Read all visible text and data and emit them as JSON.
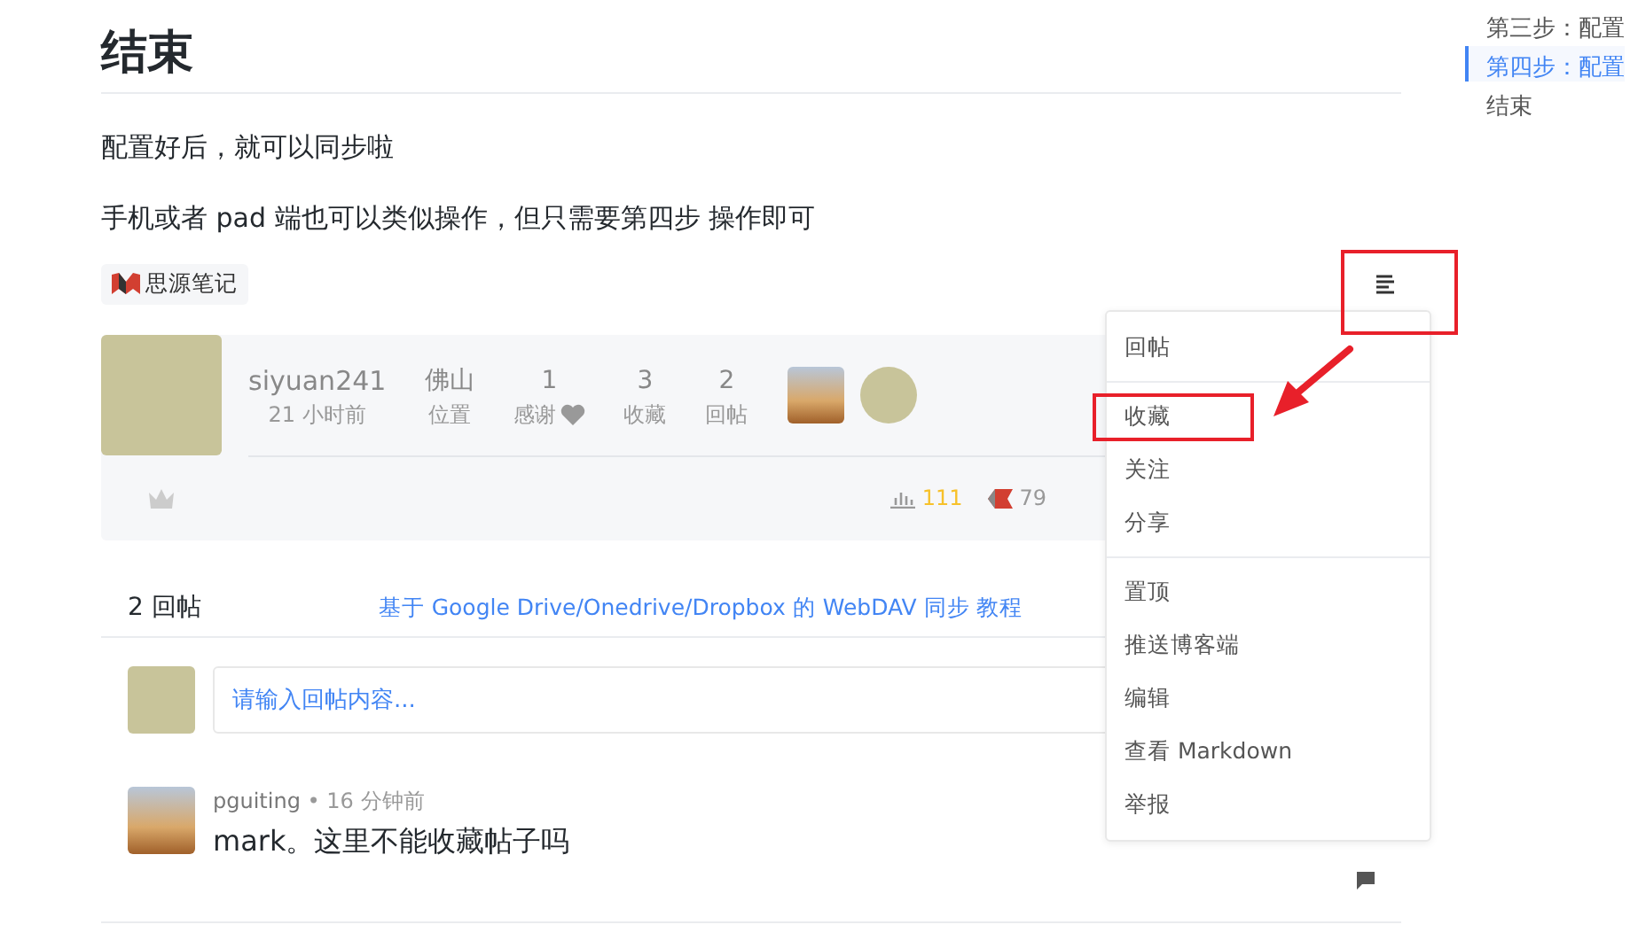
{
  "article": {
    "heading": "结束",
    "paragraphs": [
      "配置好后，就可以同步啦",
      "手机或者 pad 端也可以类似操作，但只需要第四步 操作即可"
    ],
    "tag": "思源笔记"
  },
  "menu_button": {
    "annotated": true
  },
  "post": {
    "author": "siyuan241",
    "time": "21 小时前",
    "location": "佛山",
    "location_label": "位置",
    "stats": [
      {
        "value": "1",
        "label": "感谢",
        "heart": true
      },
      {
        "value": "3",
        "label": "收藏",
        "heart": false
      },
      {
        "value": "2",
        "label": "回帖",
        "heart": false
      }
    ],
    "views": "111",
    "points": "79"
  },
  "replies_bar": {
    "count": "2 回帖",
    "link": "基于 Google Drive/Onedrive/Dropbox 的 WebDAV 同步 教程"
  },
  "reply_input": {
    "placeholder": "请输入回帖内容..."
  },
  "comments": [
    {
      "author": "pguiting",
      "separator": "•",
      "time": "16 分钟前",
      "text": "mark。这里不能收藏帖子吗"
    }
  ],
  "menu": {
    "groups": [
      [
        {
          "label": "回帖",
          "annotated": false
        }
      ],
      [
        {
          "label": "收藏",
          "annotated": true
        },
        {
          "label": "关注",
          "annotated": false
        },
        {
          "label": "分享",
          "annotated": false
        }
      ],
      [
        {
          "label": "置顶",
          "annotated": false
        },
        {
          "label": "推送博客端",
          "annotated": false
        },
        {
          "label": "编辑",
          "annotated": false
        },
        {
          "label": "查看 Markdown",
          "annotated": false
        },
        {
          "label": "举报",
          "annotated": false
        }
      ]
    ]
  },
  "toc": [
    {
      "label": "第三步：配置",
      "selected": false
    },
    {
      "label": "第四步：配置",
      "selected": true
    },
    {
      "label": "结束",
      "selected": false
    }
  ]
}
